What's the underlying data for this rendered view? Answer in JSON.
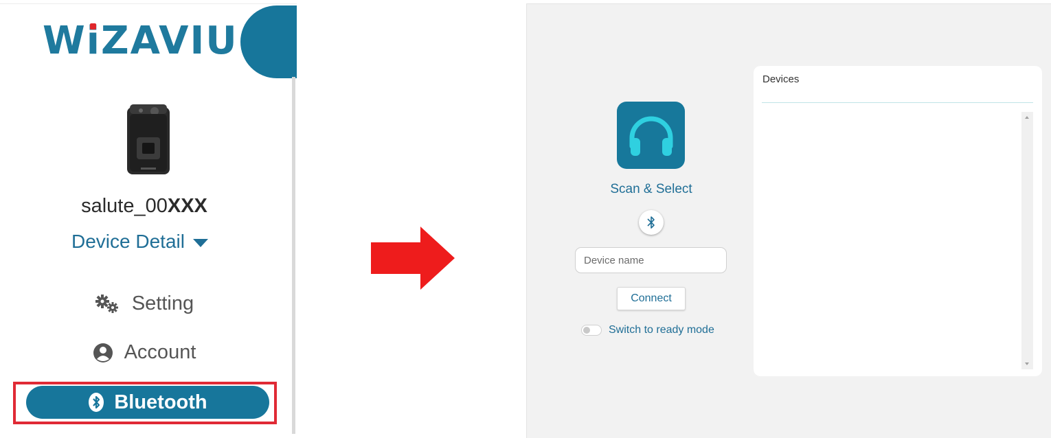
{
  "sidebar": {
    "logo_text": "WiZAVIU",
    "device": {
      "name_prefix": "salute_00",
      "name_suffix": "XXX",
      "image_icon": "body-camera-image"
    },
    "device_detail_label": "Device Detail",
    "menu": [
      {
        "label": "Setting",
        "icon": "gears-icon"
      },
      {
        "label": "Account",
        "icon": "user-circle-icon"
      },
      {
        "label": "Bluetooth",
        "icon": "bluetooth-icon",
        "selected": true
      }
    ],
    "highlight_color": "#e02a35"
  },
  "arrow": {
    "color": "#ee1c1c",
    "direction": "right"
  },
  "bluetooth_page": {
    "app_icon": "headphones-icon",
    "title": "Scan & Select",
    "scan_button_icon": "bluetooth-icon",
    "device_name_input": {
      "placeholder": "Device name",
      "value": ""
    },
    "connect_label": "Connect",
    "ready_mode": {
      "label": "Switch to ready mode",
      "enabled": false
    },
    "devices_panel": {
      "title": "Devices",
      "items": []
    }
  },
  "colors": {
    "brand": "#17769b",
    "text_accent": "#1f6e96",
    "panel_bg": "#f2f2f2"
  }
}
